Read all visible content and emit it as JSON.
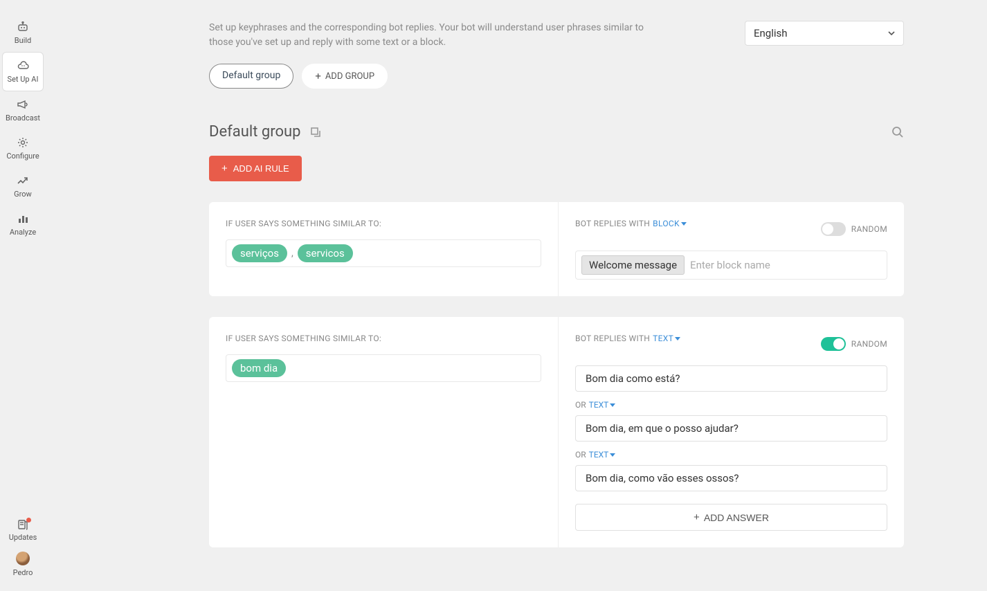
{
  "sidebar": {
    "items": [
      {
        "label": "Build"
      },
      {
        "label": "Set Up AI"
      },
      {
        "label": "Broadcast"
      },
      {
        "label": "Configure"
      },
      {
        "label": "Grow"
      },
      {
        "label": "Analyze"
      }
    ],
    "updates_label": "Updates",
    "user_name": "Pedro"
  },
  "header": {
    "description": "Set up keyphrases and the corresponding bot replies. Your bot will understand user phrases similar to those you've set up and reply with some text or a block.",
    "language": "English"
  },
  "groups": {
    "active": "Default group",
    "add_label": "ADD GROUP"
  },
  "section": {
    "title": "Default group",
    "add_rule_label": "ADD AI RULE"
  },
  "labels": {
    "if_user_says": "IF USER SAYS SOMETHING SIMILAR TO:",
    "bot_replies_with": "BOT REPLIES WITH",
    "block": "BLOCK",
    "text": "TEXT",
    "random": "RANDOM",
    "or": "OR",
    "add_answer": "ADD ANSWER",
    "block_placeholder": "Enter block name"
  },
  "rules": [
    {
      "phrases": [
        "serviços",
        "servicos"
      ],
      "reply_type": "BLOCK",
      "random": false,
      "block": "Welcome message"
    },
    {
      "phrases": [
        "bom dia"
      ],
      "reply_type": "TEXT",
      "random": true,
      "answers": [
        "Bom dia como está?",
        "Bom dia, em que o posso ajudar?",
        "Bom dia, como vão esses ossos?"
      ]
    }
  ]
}
